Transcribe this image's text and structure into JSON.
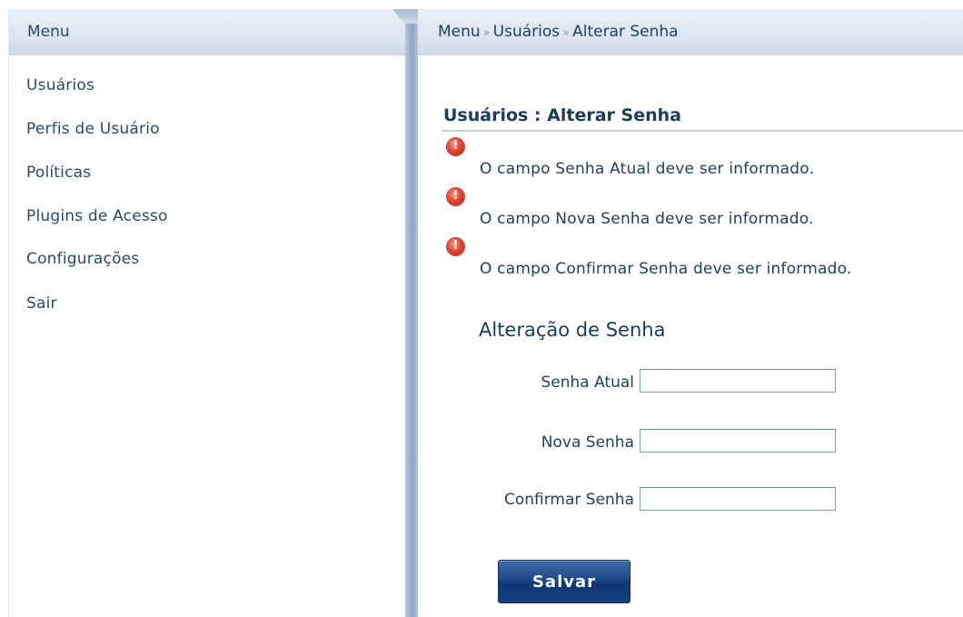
{
  "sidebar": {
    "header": "Menu",
    "items": [
      {
        "label": "Usuários"
      },
      {
        "label": "Perfis de Usuário"
      },
      {
        "label": "Políticas"
      },
      {
        "label": "Plugins de Acesso"
      },
      {
        "label": "Configurações"
      },
      {
        "label": "Sair"
      }
    ]
  },
  "breadcrumb": {
    "root": "Menu",
    "separator": "»",
    "section": "Usuários",
    "current": "Alterar Senha"
  },
  "main": {
    "title": "Usuários : Alterar Senha",
    "errors": [
      "O campo Senha Atual deve ser informado.",
      "O campo Nova Senha deve ser informado.",
      "O campo Confirmar Senha deve ser informado."
    ],
    "form": {
      "title": "Alteração de Senha",
      "fields": [
        {
          "label": "Senha Atual",
          "value": ""
        },
        {
          "label": "Nova Senha",
          "value": ""
        },
        {
          "label": "Confirmar Senha",
          "value": ""
        }
      ],
      "submit_label": "Salvar"
    }
  },
  "colors": {
    "error_icon": "#e2452f",
    "button_bg": "#1e4a8a",
    "text": "#1c3b5a"
  }
}
